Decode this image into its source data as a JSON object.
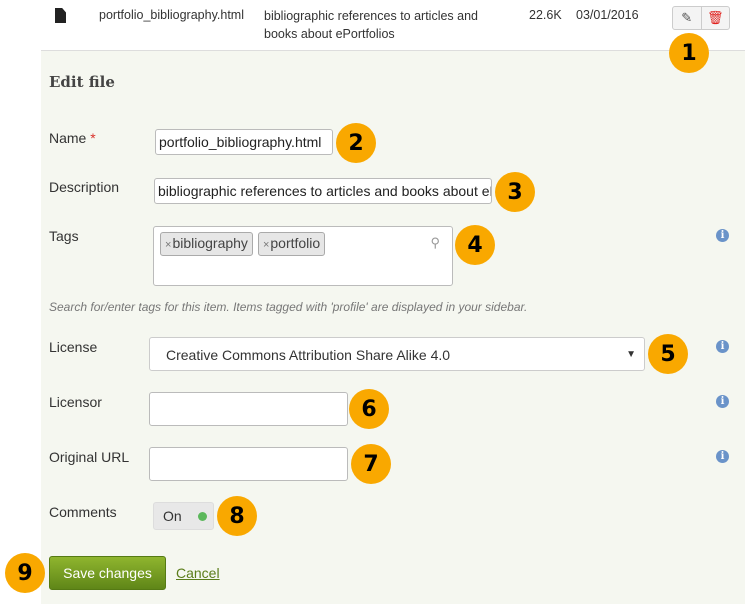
{
  "file_row": {
    "icon": "file-icon",
    "name": "portfolio_bibliography.html",
    "description": "bibliographic references to articles and books about ePortfolios",
    "size": "22.6K",
    "date": "03/01/2016"
  },
  "section_title": "Edit file",
  "fields": {
    "name": {
      "label": "Name",
      "required": "*",
      "value": "portfolio_bibliography.html"
    },
    "description": {
      "label": "Description",
      "value": "bibliographic references to articles and books about ePortfolios"
    },
    "tags": {
      "label": "Tags",
      "items": [
        "bibliography",
        "portfolio"
      ],
      "remove": "×",
      "help": "Search for/enter tags for this item. Items tagged with 'profile' are displayed in your sidebar."
    },
    "license": {
      "label": "License",
      "value": "Creative Commons Attribution Share Alike 4.0"
    },
    "licensor": {
      "label": "Licensor",
      "value": ""
    },
    "original_url": {
      "label": "Original URL",
      "value": ""
    },
    "comments": {
      "label": "Comments",
      "value": "On"
    }
  },
  "buttons": {
    "save": "Save changes",
    "cancel": "Cancel"
  },
  "callouts": [
    "1",
    "2",
    "3",
    "4",
    "5",
    "6",
    "7",
    "8",
    "9"
  ],
  "colors": {
    "callout": "#f9a800",
    "save": "#6f961c",
    "delete": "#e0201c",
    "toggle_on": "#5cb85c"
  }
}
